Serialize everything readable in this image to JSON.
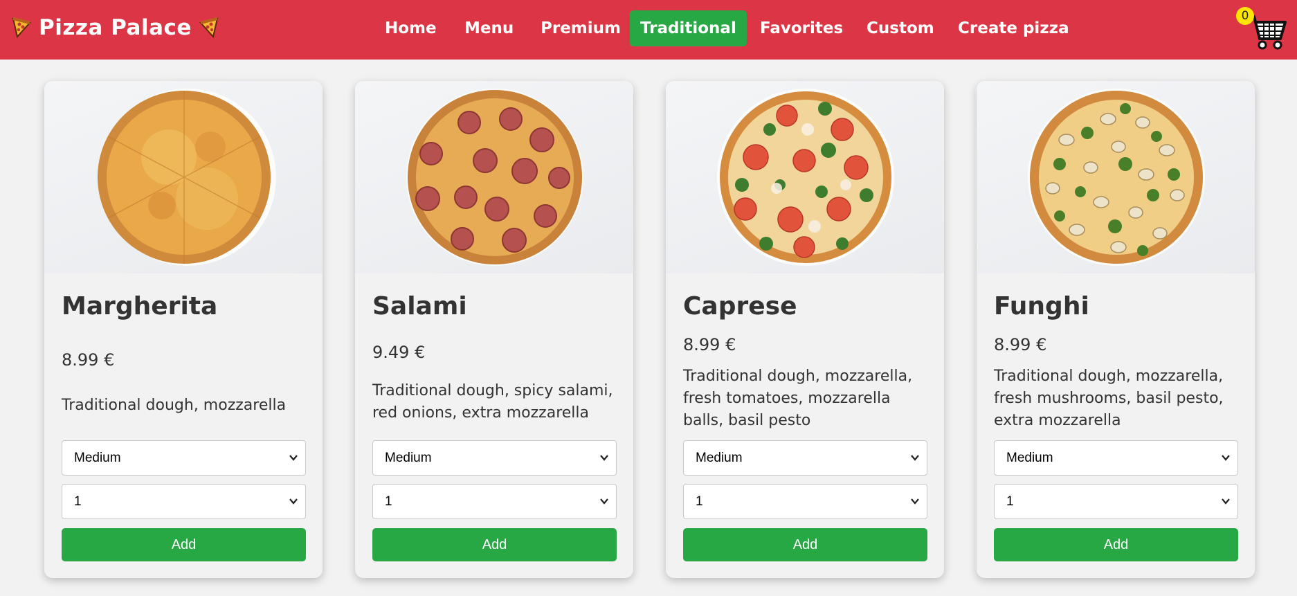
{
  "brand": {
    "title": "Pizza Palace"
  },
  "nav": {
    "items": [
      {
        "label": "Home"
      },
      {
        "label": "Menu"
      },
      {
        "label": "Premium"
      },
      {
        "label": "Traditional"
      },
      {
        "label": "Favorites"
      },
      {
        "label": "Custom"
      },
      {
        "label": "Create pizza"
      }
    ],
    "active": "Traditional"
  },
  "cart": {
    "count": "0",
    "icon": "cart-icon"
  },
  "colors": {
    "header": "#dc3545",
    "accent": "#28a745",
    "badge": "#ffe600",
    "background": "#f2f2f2"
  },
  "products": [
    {
      "name": "Margherita",
      "price": "8.99 €",
      "description": "Traditional dough, mozzarella",
      "size": "Medium",
      "quantity": "1",
      "button": "Add",
      "topping": "cheese"
    },
    {
      "name": "Salami",
      "price": "9.49 €",
      "description": "Traditional dough, spicy salami, red onions, extra mozzarella",
      "size": "Medium",
      "quantity": "1",
      "button": "Add",
      "topping": "salami"
    },
    {
      "name": "Caprese",
      "price": "8.99 €",
      "description": "Traditional dough, mozzarella, fresh tomatoes, mozzarella balls, basil pesto",
      "size": "Medium",
      "quantity": "1",
      "button": "Add",
      "topping": "tomato-basil"
    },
    {
      "name": "Funghi",
      "price": "8.99 €",
      "description": "Traditional dough, mozzarella, fresh mushrooms, basil pesto, extra mozzarella",
      "size": "Medium",
      "quantity": "1",
      "button": "Add",
      "topping": "mushroom-pesto"
    }
  ]
}
